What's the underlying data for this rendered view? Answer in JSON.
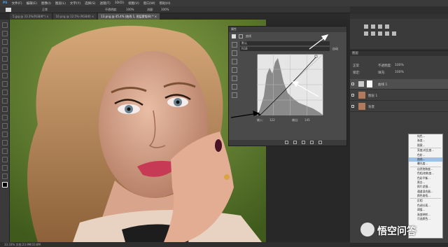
{
  "menu": {
    "items": [
      "PS",
      "文件(F)",
      "编辑(E)",
      "图像(I)",
      "图层(L)",
      "文字(Y)",
      "选择(S)",
      "滤镜(T)",
      "3D(D)",
      "视图(V)",
      "窗口(W)",
      "帮助(H)"
    ]
  },
  "options_bar": {
    "fields": [
      "正常",
      "不透明度:",
      "100%",
      "流量:",
      "100%"
    ]
  },
  "tabs": [
    {
      "label": "5.jpg @ 33.3%(RGB/8*) ×"
    },
    {
      "label": "10.png @ 12.5% (RGB/8) ×"
    },
    {
      "label": "13.png @ 45.4% (曲线 1, 图层蒙版/8) * ×"
    }
  ],
  "status": {
    "text": "33.33%   文档:23.9M/33.8M"
  },
  "curves": {
    "panel_title": "属性",
    "panel_subtitle": "曲线",
    "preset_value": "默认",
    "channel_value": "RGB",
    "auto_label": "自动",
    "input_label": "输入:",
    "input_value": "122",
    "output_label": "输出:",
    "output_value": "145"
  },
  "layers": {
    "title": "图层",
    "blend_mode": "正常",
    "opacity_label": "不透明度:",
    "opacity": "100%",
    "lock_label": "锁定:",
    "fill_label": "填充:",
    "fill": "100%",
    "items": [
      {
        "name": "曲线 1"
      },
      {
        "name": "图层 1"
      },
      {
        "name": "背景"
      }
    ]
  },
  "context_menu": {
    "items": [
      "纯色...",
      "渐变...",
      "图案...",
      "亮度/对比度...",
      "色阶...",
      "曲线...",
      "曝光度...",
      "自然饱和度...",
      "色相/饱和度...",
      "色彩平衡...",
      "黑白...",
      "照片滤镜...",
      "通道混合器...",
      "颜色查找...",
      "反相",
      "色调分离...",
      "阈值...",
      "渐变映射...",
      "可选颜色..."
    ],
    "selected_index": 5
  },
  "watermark": {
    "text": "悟空问答"
  },
  "colors": {
    "accent": "#9fc1e6",
    "arrow": "#d42a2a"
  }
}
